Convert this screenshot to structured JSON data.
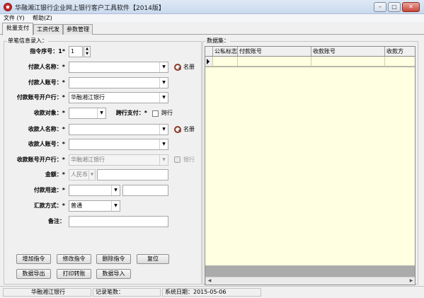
{
  "window": {
    "title": "华融湘江银行企业网上银行客户工具软件【2014版】",
    "min_glyph": "–",
    "max_glyph": "□",
    "close_glyph": "✕"
  },
  "menu": {
    "items": [
      "文件 (Y)",
      "帮助(Z)"
    ]
  },
  "tabs": [
    "批量支付",
    "工资代发",
    "参数管理"
  ],
  "left_panel": {
    "legend": "单笔信息录入：",
    "seq_label": "指令序号：1*",
    "seq_value": "1",
    "payer_name_label": "付款人名称：*",
    "payer_account_label": "付款人账号：*",
    "payer_bank_label": "付款账号开户行：*",
    "payer_bank_value": "华融湘江银行",
    "payee_type_label": "收款对象：*",
    "cross_bank_label": "跨行支付：*",
    "cross_bank_checkbox_label": "跨行",
    "payee_name_label": "收款人名称：*",
    "payee_account_label": "收款人账号：*",
    "payee_bank_label": "收款账号开户行：*",
    "payee_bank_value": "华融湘江银行",
    "amount_label": "金额：*",
    "currency_value": "人民币",
    "purpose_label": "付款用途：*",
    "remit_label": "汇款方式：*",
    "remit_value": "普通",
    "remark_label": "备注：",
    "directory_link": "名册",
    "bank_link": "银行"
  },
  "buttons": {
    "add": "增加指令",
    "modify": "修改指令",
    "delete": "删除指令",
    "reset": "复位",
    "export": "数据导出",
    "print": "打印转账",
    "import": "数据导入"
  },
  "dataset": {
    "legend": "数据集：",
    "columns": [
      "公私标志",
      "付款账号",
      "收款账号",
      "收款方"
    ]
  },
  "status": {
    "bank": "华融湘江银行",
    "record_count": "记录笔数：",
    "system_date": "系统日期：2015-05-06"
  },
  "icons": {
    "app": "bank-logo-icon",
    "search": "magnifier-icon",
    "bank": "bank-icon"
  },
  "colors": {
    "grid_row_bg": "#ffffe1",
    "close_button": "#c8453a"
  }
}
